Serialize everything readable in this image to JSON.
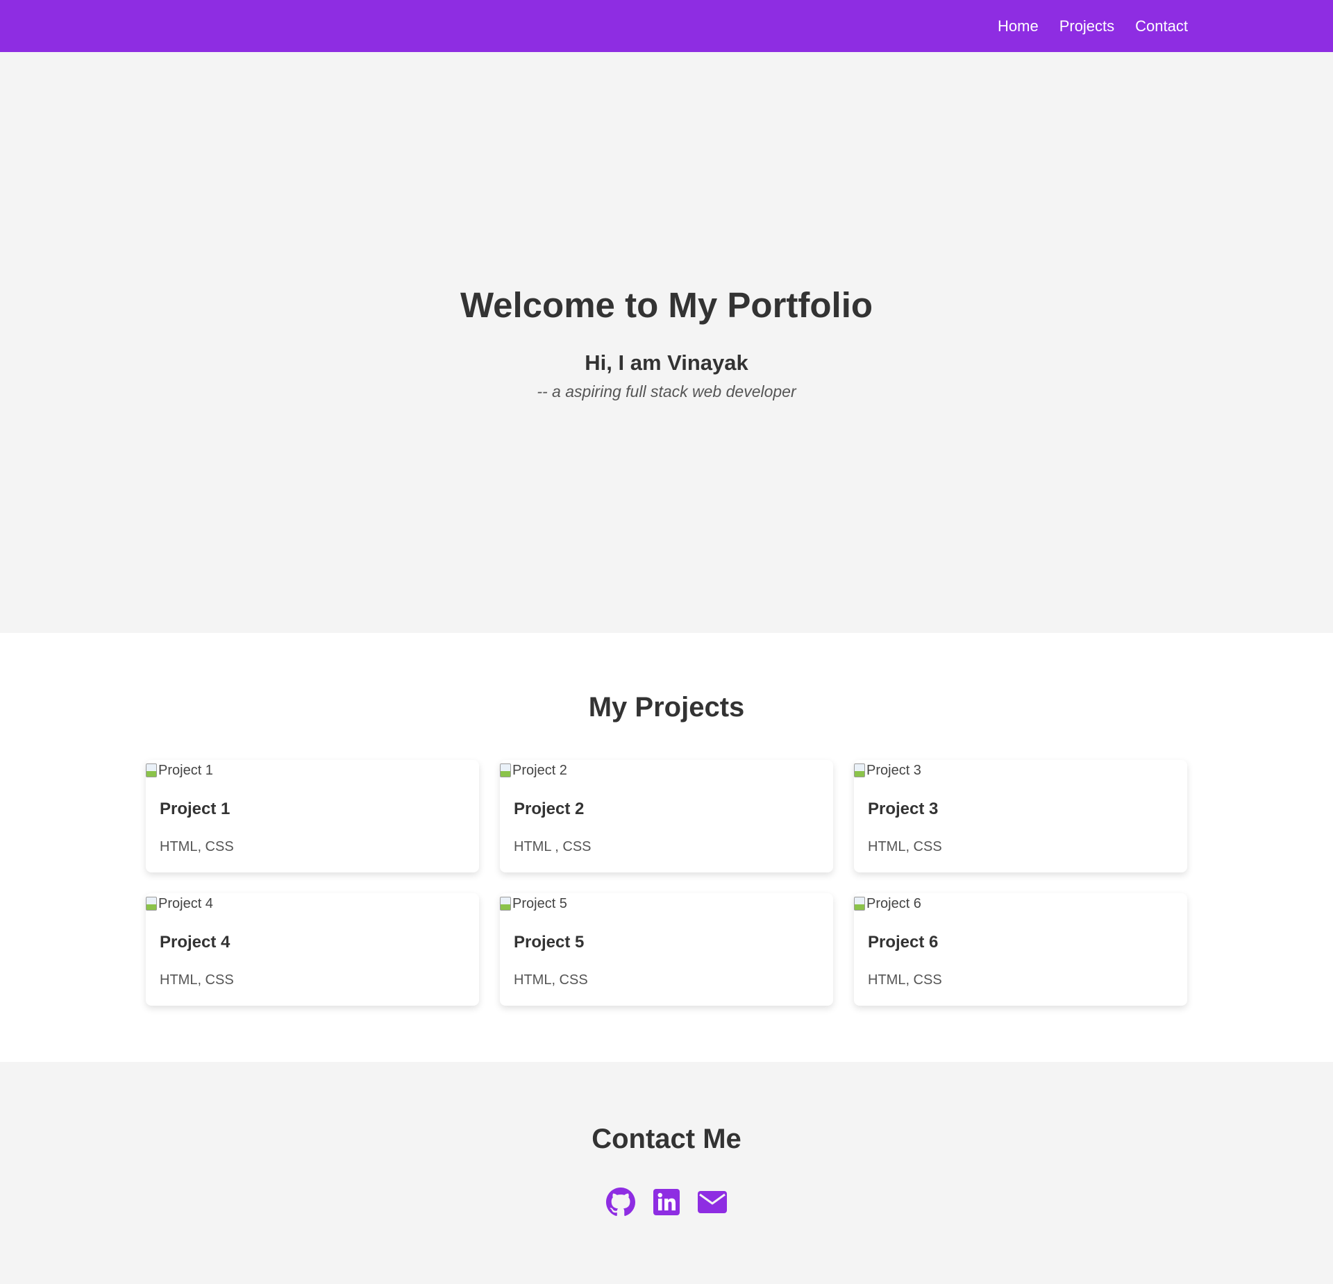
{
  "nav": {
    "links": [
      "Home",
      "Projects",
      "Contact"
    ]
  },
  "hero": {
    "title": "Welcome to My Portfolio",
    "greeting": "Hi, I am Vinayak",
    "tagline": "-- a aspiring full stack web developer"
  },
  "projects": {
    "title": "My Projects",
    "items": [
      {
        "img_alt": "Project 1",
        "name": "Project 1",
        "tech": "HTML, CSS"
      },
      {
        "img_alt": "Project 2",
        "name": "Project 2",
        "tech": "HTML , CSS"
      },
      {
        "img_alt": "Project 3",
        "name": "Project 3",
        "tech": "HTML, CSS"
      },
      {
        "img_alt": "Project 4",
        "name": "Project 4",
        "tech": "HTML, CSS"
      },
      {
        "img_alt": "Project 5",
        "name": "Project 5",
        "tech": "HTML, CSS"
      },
      {
        "img_alt": "Project 6",
        "name": "Project 6",
        "tech": "HTML, CSS"
      }
    ]
  },
  "contact": {
    "title": "Contact Me",
    "icons": [
      "github-icon",
      "linkedin-icon",
      "envelope-icon"
    ]
  },
  "colors": {
    "accent": "#8e2de2",
    "background": "#f4f4f4",
    "text": "#333333"
  }
}
